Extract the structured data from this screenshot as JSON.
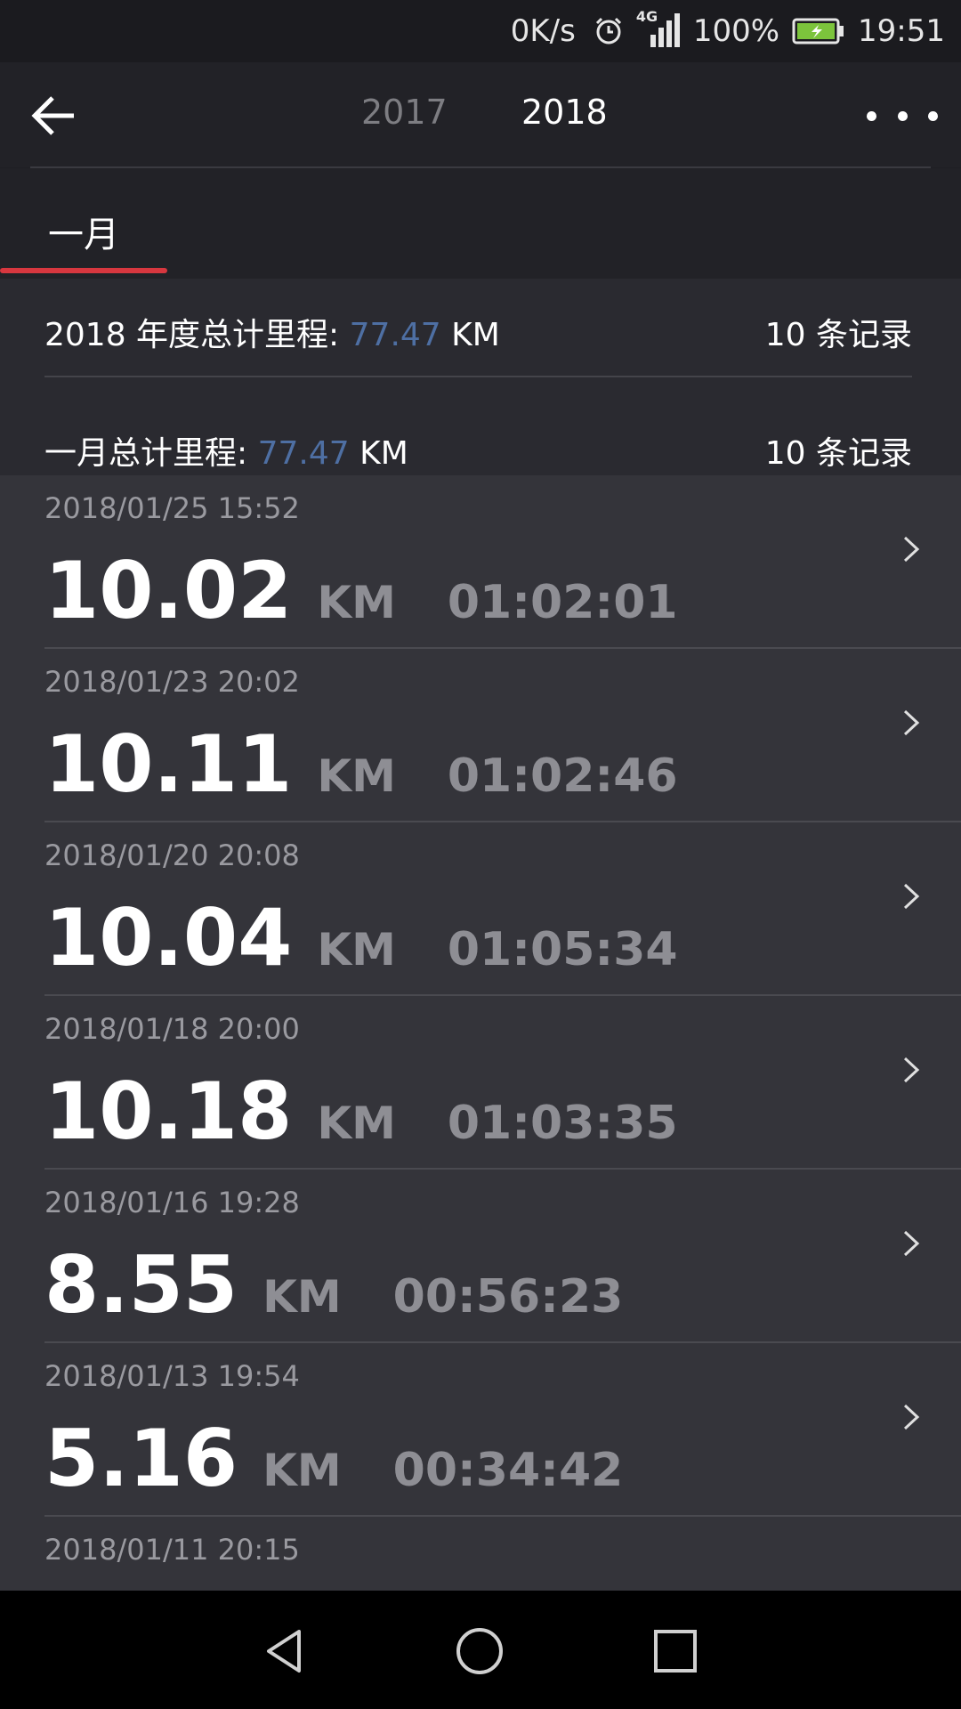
{
  "status_bar": {
    "net_speed": "0K/s",
    "network": "4G",
    "battery": "100%",
    "time": "19:51"
  },
  "header": {
    "back_icon": "arrow-left-icon",
    "years": [
      "2017",
      "2018"
    ],
    "selected_year": "2018",
    "more_icon": "more-dots-icon"
  },
  "month_tabs": {
    "items": [
      "一月"
    ],
    "selected": "一月",
    "accent_color": "#d7373f"
  },
  "summary": {
    "year_label": "2018 年度总计里程: ",
    "year_km": "77.47",
    "year_unit": " KM",
    "year_records": "10 条记录",
    "month_label": "一月总计里程: ",
    "month_km": "77.47",
    "month_unit": " KM",
    "month_records": "10 条记录",
    "value_color": "#4e6fa3"
  },
  "runs": [
    {
      "date": "2018/01/25 15:52",
      "distance": "10.02",
      "unit": "KM",
      "duration": "01:02:01"
    },
    {
      "date": "2018/01/23 20:02",
      "distance": "10.11",
      "unit": "KM",
      "duration": "01:02:46"
    },
    {
      "date": "2018/01/20 20:08",
      "distance": "10.04",
      "unit": "KM",
      "duration": "01:05:34"
    },
    {
      "date": "2018/01/18 20:00",
      "distance": "10.18",
      "unit": "KM",
      "duration": "01:03:35"
    },
    {
      "date": "2018/01/16 19:28",
      "distance": "8.55",
      "unit": "KM",
      "duration": "00:56:23"
    },
    {
      "date": "2018/01/13 19:54",
      "distance": "5.16",
      "unit": "KM",
      "duration": "00:34:42"
    },
    {
      "date": "2018/01/11 20:15",
      "distance": "",
      "unit": "",
      "duration": ""
    }
  ],
  "nav_bar": {
    "back_icon": "triangle-back-icon",
    "home_icon": "circle-home-icon",
    "recent_icon": "square-recents-icon"
  }
}
